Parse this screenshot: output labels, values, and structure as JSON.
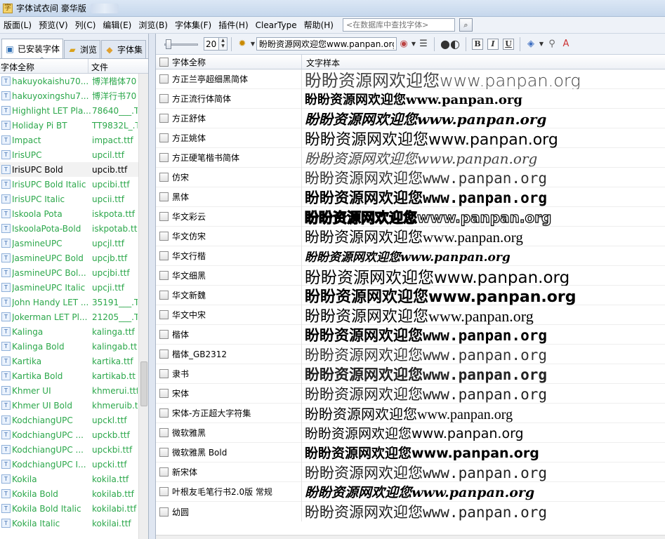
{
  "window": {
    "title": "字体试衣间 豪华版"
  },
  "menu": {
    "items": [
      "版面(L)",
      "预览(V)",
      "列(C)",
      "编辑(E)",
      "浏览(B)",
      "字体集(F)",
      "插件(H)",
      "ClearType",
      "帮助(H)"
    ],
    "search_placeholder": "<在数据库中查找字体>"
  },
  "left": {
    "tabs": [
      "已安装字体",
      "浏览",
      "字体集"
    ],
    "col_name": "字体全称",
    "col_file": "文件",
    "fonts": [
      {
        "name": "hakuyokaishu70...",
        "file": "博洋楷体70"
      },
      {
        "name": "hakuyoxingshu7...",
        "file": "博洋行书70"
      },
      {
        "name": "Highlight LET Pla...",
        "file": "78640___.T"
      },
      {
        "name": "Holiday Pi BT",
        "file": "TT9832L_.T"
      },
      {
        "name": "Impact",
        "file": "impact.ttf"
      },
      {
        "name": "IrisUPC",
        "file": "upcil.ttf"
      },
      {
        "name": "IrisUPC Bold",
        "file": "upcib.ttf",
        "selected": true
      },
      {
        "name": "IrisUPC Bold Italic",
        "file": "upcibi.ttf"
      },
      {
        "name": "IrisUPC Italic",
        "file": "upcii.ttf"
      },
      {
        "name": "Iskoola Pota",
        "file": "iskpota.ttf"
      },
      {
        "name": "IskoolaPota-Bold",
        "file": "iskpotab.tt"
      },
      {
        "name": "JasmineUPC",
        "file": "upcjl.ttf"
      },
      {
        "name": "JasmineUPC Bold",
        "file": "upcjb.ttf"
      },
      {
        "name": "JasmineUPC Bol...",
        "file": "upcjbi.ttf"
      },
      {
        "name": "JasmineUPC Italic",
        "file": "upcji.ttf"
      },
      {
        "name": "John Handy LET ...",
        "file": "35191___.T"
      },
      {
        "name": "Jokerman LET Pl...",
        "file": "21205___.T"
      },
      {
        "name": "Kalinga",
        "file": "kalinga.ttf"
      },
      {
        "name": "Kalinga Bold",
        "file": "kalingab.tt"
      },
      {
        "name": "Kartika",
        "file": "kartika.ttf"
      },
      {
        "name": "Kartika Bold",
        "file": "kartikab.tt"
      },
      {
        "name": "Khmer UI",
        "file": "khmerui.ttf"
      },
      {
        "name": "Khmer UI Bold",
        "file": "khmeruib.t"
      },
      {
        "name": "KodchiangUPC",
        "file": "upckl.ttf"
      },
      {
        "name": "KodchiangUPC ...",
        "file": "upckb.ttf"
      },
      {
        "name": "KodchiangUPC ...",
        "file": "upckbi.ttf"
      },
      {
        "name": "KodchiangUPC I...",
        "file": "upcki.ttf"
      },
      {
        "name": "Kokila",
        "file": "kokila.ttf"
      },
      {
        "name": "Kokila Bold",
        "file": "kokilab.ttf"
      },
      {
        "name": "Kokila Bold Italic",
        "file": "kokilabi.ttf"
      },
      {
        "name": "Kokila Italic",
        "file": "kokilai.ttf"
      }
    ]
  },
  "toolbar": {
    "size": "20",
    "sample_text": "盼盼资源网欢迎您www.panpan.org",
    "btn_bold": "B",
    "btn_italic": "I",
    "btn_underline": "U"
  },
  "table": {
    "col_name": "字体全称",
    "col_sample": "文字样本",
    "sample": "盼盼资源网欢迎您www.panpan.org",
    "rows": [
      {
        "name": "方正兰亭超细黑简体"
      },
      {
        "name": "方正流行体简体"
      },
      {
        "name": "方正舒体"
      },
      {
        "name": "方正姚体"
      },
      {
        "name": "方正硬笔楷书简体"
      },
      {
        "name": "仿宋"
      },
      {
        "name": "黑体"
      },
      {
        "name": "华文彩云"
      },
      {
        "name": "华文仿宋"
      },
      {
        "name": "华文行楷"
      },
      {
        "name": "华文细黑"
      },
      {
        "name": "华文新魏"
      },
      {
        "name": "华文中宋"
      },
      {
        "name": "楷体"
      },
      {
        "name": "楷体_GB2312"
      },
      {
        "name": "隶书"
      },
      {
        "name": "宋体"
      },
      {
        "name": "宋体-方正超大字符集"
      },
      {
        "name": "微软雅黑"
      },
      {
        "name": "微软雅黑 Bold"
      },
      {
        "name": "新宋体"
      },
      {
        "name": "叶根友毛笔行书2.0版 常规"
      },
      {
        "name": "幼圆"
      }
    ]
  },
  "colors": {
    "installed_font_green": "#2ba74a",
    "menubar_bg": "#eef2f8"
  }
}
